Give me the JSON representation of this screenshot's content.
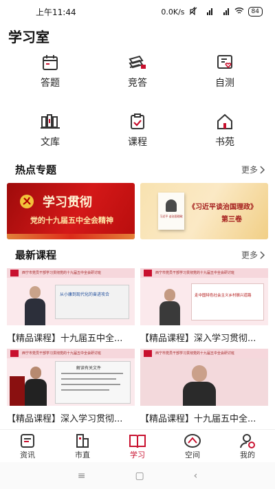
{
  "status_bar": {
    "time": "上午11:44",
    "net_speed": "0.0K/s",
    "signal1": "5G",
    "signal2": "5G",
    "battery": "84"
  },
  "page_title": "学习室",
  "grid": [
    {
      "label": "答题",
      "icon": "calendar-icon"
    },
    {
      "label": "竞答",
      "icon": "books-icon"
    },
    {
      "label": "自测",
      "icon": "self-test-icon"
    },
    {
      "label": "文库",
      "icon": "library-icon"
    },
    {
      "label": "课程",
      "icon": "clipboard-check-icon"
    },
    {
      "label": "书苑",
      "icon": "house-icon"
    }
  ],
  "hot_section": {
    "title": "热点专题",
    "more": "更多"
  },
  "banners": [
    {
      "headline": "学习贯彻",
      "subline": "党的十九届五中全会精神"
    },
    {
      "headline": "《习近平谈治国理政》",
      "subline": "第三卷",
      "book_title": "习近平 谈治国理政"
    }
  ],
  "course_section": {
    "title": "最新课程",
    "more": "更多"
  },
  "thumb_header": "西宁市党员干部学习贯彻党的十九届五中全会研讨班",
  "courses": [
    {
      "title": "【精品课程】十九届五中全...",
      "slide": "从小康到现代化的奋进攻合"
    },
    {
      "title": "【精品课程】深入学习贯彻...",
      "slide": "走中国特色社会主义乡村振兴道路"
    },
    {
      "title": "【精品课程】深入学习贯彻...",
      "slide": "解读有关文件"
    },
    {
      "title": "【精品课程】十九届五中全...",
      "slide": ""
    }
  ],
  "tabs": [
    {
      "label": "资讯",
      "icon": "news-icon",
      "active": false
    },
    {
      "label": "市直",
      "icon": "building-icon",
      "active": false
    },
    {
      "label": "学习",
      "icon": "open-book-icon",
      "active": true
    },
    {
      "label": "空间",
      "icon": "space-icon",
      "active": false
    },
    {
      "label": "我的",
      "icon": "profile-icon",
      "active": false
    }
  ],
  "nav": {
    "menu": "≡",
    "home": "▢",
    "back": "‹"
  },
  "colors": {
    "accent": "#c8102e",
    "banner_red": "#c41616",
    "banner_gold": "#f8e2b0"
  }
}
